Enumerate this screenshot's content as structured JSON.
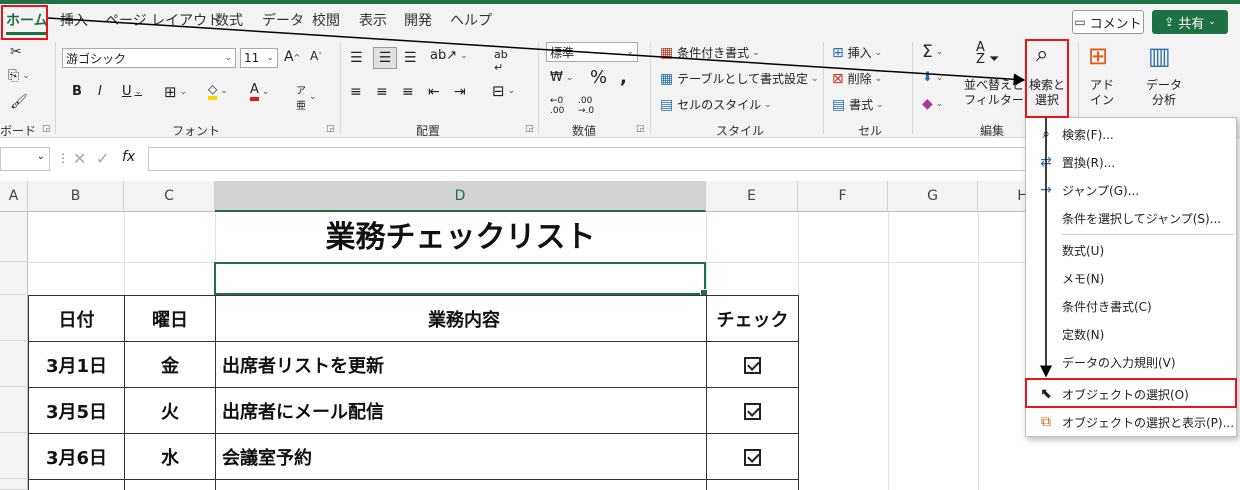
{
  "tabs": [
    "ホーム",
    "挿入",
    "ページ レイアウト",
    "数式",
    "データ",
    "校閲",
    "表示",
    "開発",
    "ヘルプ"
  ],
  "actions": {
    "comment": "コメント",
    "share": "共有"
  },
  "ribbon": {
    "font_name": "游ゴシック",
    "font_size": "11",
    "number_format": "標準",
    "group_labels": {
      "clipboard": "ボード",
      "font": "フォント",
      "alignment": "配置",
      "number": "数値",
      "style": "スタイル",
      "cells": "セル",
      "editing": "編集"
    },
    "style_items": [
      "条件付き書式",
      "テーブルとして書式設定",
      "セルのスタイル"
    ],
    "cell_items": [
      "挿入",
      "削除",
      "書式"
    ],
    "sort_filter": [
      "並べ替えと",
      "フィルター"
    ],
    "find_select": [
      "検索と",
      "選択"
    ],
    "addin": [
      "アド",
      "イン"
    ],
    "data_analysis": [
      "データ",
      "分析"
    ]
  },
  "formula_bar": {
    "fx": "fx"
  },
  "columns": [
    "A",
    "B",
    "C",
    "D",
    "E",
    "F",
    "G",
    "H"
  ],
  "sheet": {
    "title": "業務チェックリスト",
    "headers": {
      "date": "日付",
      "day": "曜日",
      "task": "業務内容",
      "check": "チェック"
    },
    "rows": [
      {
        "date": "3月1日",
        "day": "金",
        "task": "出席者リストを更新",
        "checked": true
      },
      {
        "date": "3月5日",
        "day": "火",
        "task": "出席者にメール配信",
        "checked": true
      },
      {
        "date": "3月6日",
        "day": "水",
        "task": "会議室予約",
        "checked": true
      }
    ]
  },
  "menu": {
    "items": [
      {
        "label": "検索(F)...",
        "icon": "magnifier-icon"
      },
      {
        "label": "置換(R)...",
        "icon": "replace-icon"
      },
      {
        "label": "ジャンプ(G)...",
        "icon": "arrow-right-icon"
      },
      {
        "label": "条件を選択してジャンプ(S)...",
        "icon": ""
      },
      {
        "label": "数式(U)",
        "icon": ""
      },
      {
        "label": "メモ(N)",
        "icon": ""
      },
      {
        "label": "条件付き書式(C)",
        "icon": ""
      },
      {
        "label": "定数(N)",
        "icon": ""
      },
      {
        "label": "データの入力規則(V)",
        "icon": ""
      },
      {
        "label": "オブジェクトの選択(O)",
        "icon": "pointer-icon"
      },
      {
        "label": "オブジェクトの選択と表示(P)...",
        "icon": "select-pane-icon"
      }
    ]
  },
  "colors": {
    "accent": "#1e7145",
    "annotation": "#e8141c"
  }
}
